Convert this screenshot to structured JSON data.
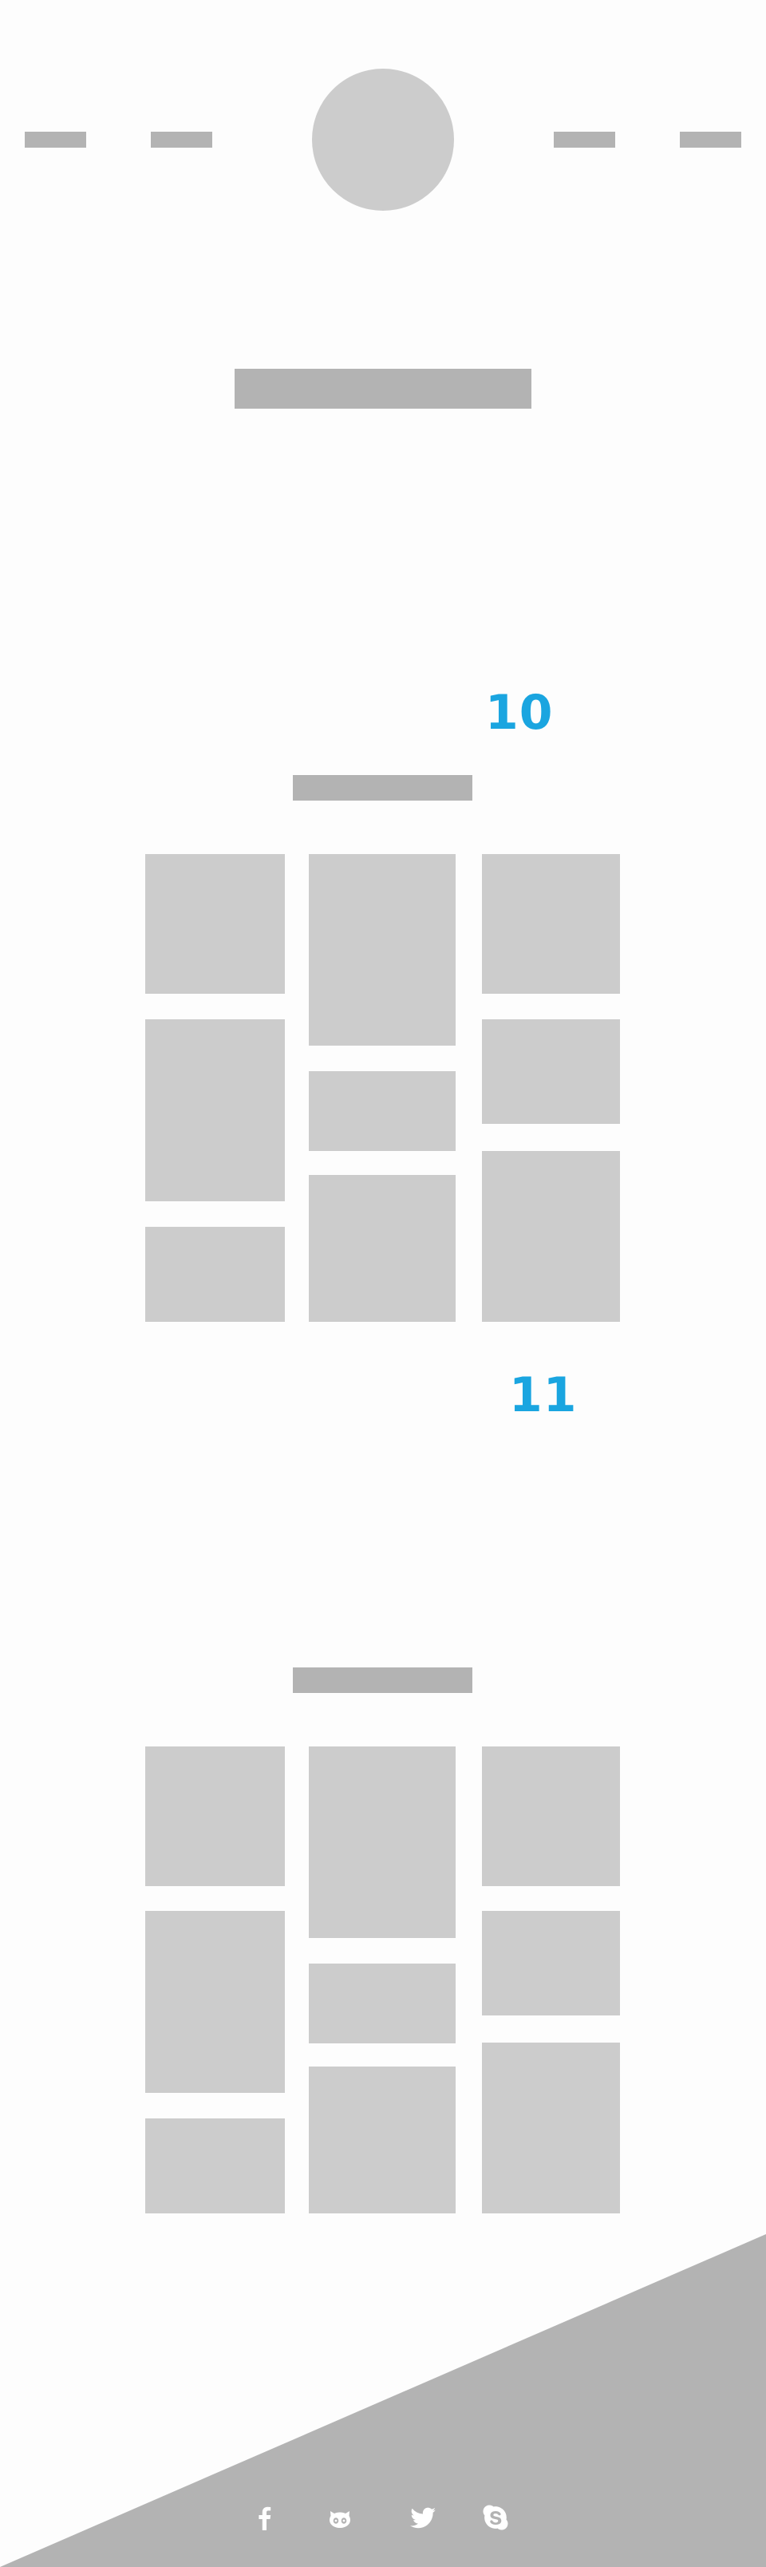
{
  "header": {
    "nav_left": [
      "",
      ""
    ],
    "nav_right": [
      "",
      ""
    ],
    "logo": "logo-placeholder"
  },
  "hero": {
    "title": ""
  },
  "sections": [
    {
      "number": "10",
      "heading": "",
      "tiles": 9
    },
    {
      "number": "11",
      "heading": "",
      "tiles": 9
    }
  ],
  "footer": {
    "social": [
      "facebook-icon",
      "github-icon",
      "twitter-icon",
      "skype-icon"
    ],
    "colors": {
      "wedge": "#b3b3b3",
      "icon": "#ffffff",
      "accent": "#1aa5e0"
    }
  }
}
